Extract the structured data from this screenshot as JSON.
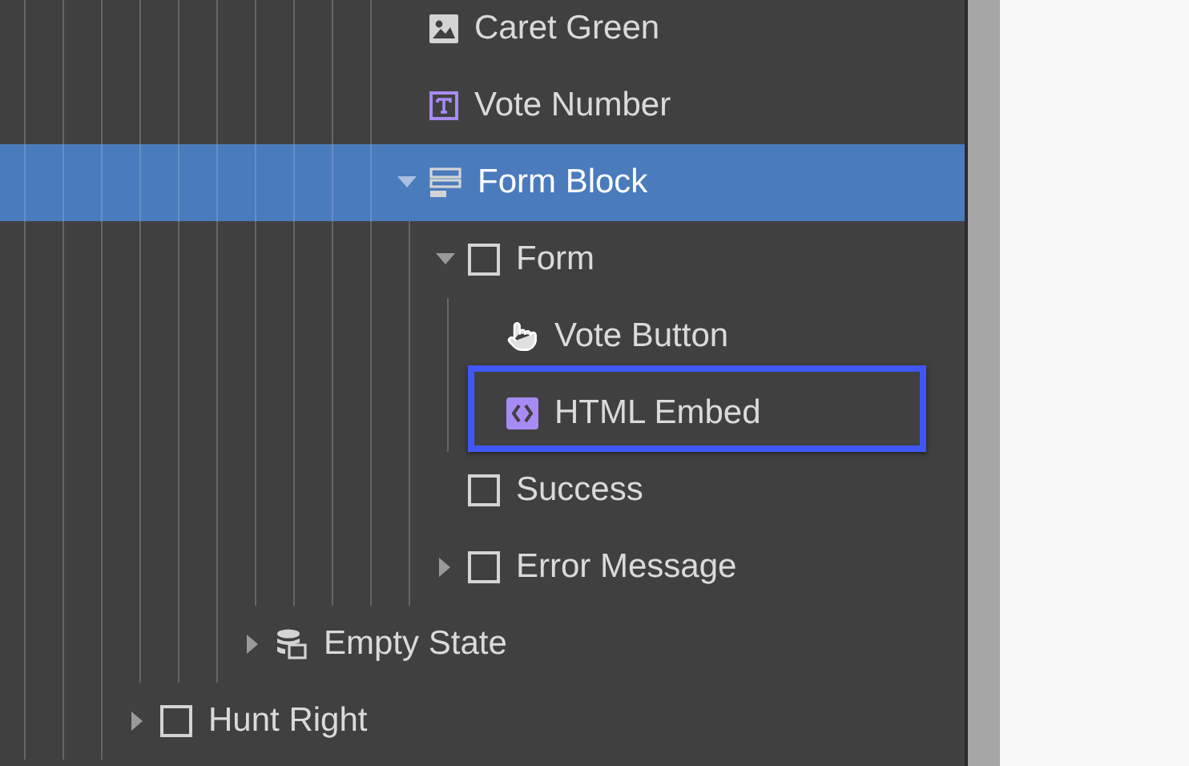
{
  "tree": [
    {
      "children": [
        {
          "children": [
            {
              "children": [
                {
                  "children": [
                    {
                      "children": [
                        {
                          "children": [
                            {
                              "children": [
                                {
                                  "children": [
                                    {
                                      "children": [
                                        {
                                          "children": [
                                            {
                                              "label": "Caret Green",
                                              "kind": "image",
                                              "selected": false,
                                              "outlined": false
                                            },
                                            {
                                              "label": "Vote Number",
                                              "kind": "text",
                                              "selected": false,
                                              "outlined": false
                                            },
                                            {
                                              "label": "Form Block",
                                              "kind": "form-block",
                                              "expanded": true,
                                              "selected": true,
                                              "outlined": false,
                                              "children": [
                                                {
                                                  "label": "Form",
                                                  "kind": "box",
                                                  "expanded": true,
                                                  "selected": false,
                                                  "outlined": false,
                                                  "children": [
                                                    {
                                                      "label": "Vote Button",
                                                      "kind": "button",
                                                      "selected": false,
                                                      "outlined": false
                                                    },
                                                    {
                                                      "label": "HTML Embed",
                                                      "kind": "embed",
                                                      "selected": false,
                                                      "outlined": true
                                                    }
                                                  ]
                                                },
                                                {
                                                  "label": "Success",
                                                  "kind": "box",
                                                  "selected": false,
                                                  "outlined": false
                                                },
                                                {
                                                  "label": "Error Message",
                                                  "kind": "box",
                                                  "expanded": false,
                                                  "selected": false,
                                                  "outlined": false
                                                }
                                              ]
                                            }
                                          ]
                                        }
                                      ]
                                    }
                                  ]
                                }
                              ]
                            },
                            {
                              "label": "Empty State",
                              "kind": "collection",
                              "expanded": false,
                              "selected": false,
                              "outlined": false
                            }
                          ]
                        }
                      ]
                    }
                  ]
                },
                {
                  "label": "Hunt Right",
                  "kind": "box",
                  "expanded": false,
                  "selected": false,
                  "outlined": false
                }
              ]
            }
          ]
        }
      ]
    }
  ]
}
